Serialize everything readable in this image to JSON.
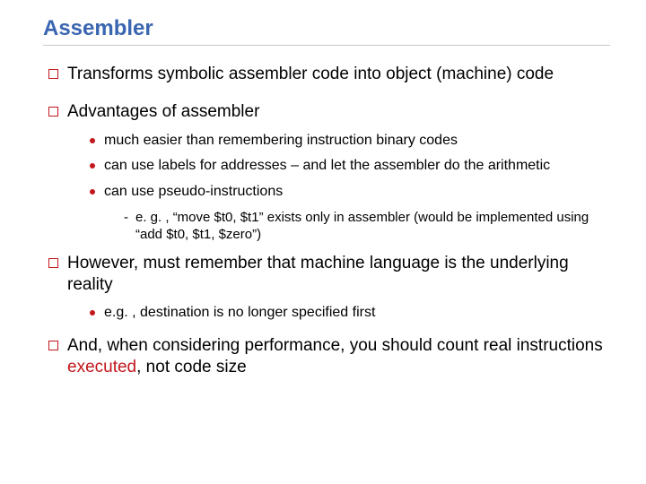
{
  "title": "Assembler",
  "b1": "Transforms symbolic assembler code into object (machine) code",
  "b2": "Advantages of assembler",
  "b2a": "much easier than remembering instruction binary codes",
  "b2b": "can use labels for addresses – and let the assembler do the arithmetic",
  "b2c": "can use pseudo-instructions",
  "b2c1": "e. g. , “move $t0, $t1” exists only in assembler (would be implemented using “add $t0, $t1, $zero”)",
  "b3": "However, must remember that machine language is the underlying reality",
  "b3a": "e.g. , destination is no longer specified first",
  "b4_pre": "And, when considering performance, you should count real instructions ",
  "b4_red": "executed",
  "b4_post": ", not code size"
}
